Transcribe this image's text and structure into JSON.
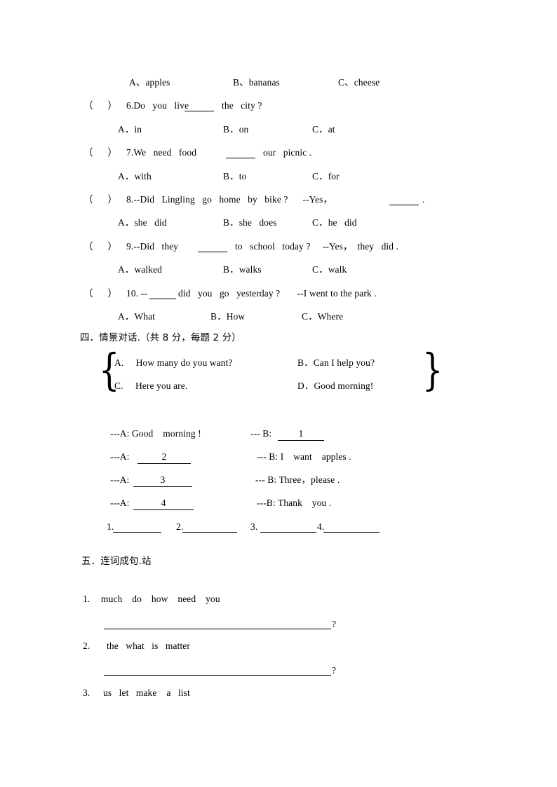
{
  "document": {
    "kind": "english-exam-worksheet-page"
  },
  "choices_top": {
    "a": "A、apples",
    "b": "B、bananas",
    "c": "C、cheese"
  },
  "multiple_choice": [
    {
      "marker": "（      ）",
      "stem_before": "6.Do   you   live",
      "stem_after": "the   city ?",
      "tail": "",
      "options": {
        "a": "A．in",
        "b": "B．on",
        "c": "C．at"
      }
    },
    {
      "marker": "（      ）",
      "stem_before": "7.We   need   food",
      "stem_after": "our   picnic .",
      "tail": "",
      "options": {
        "a": "A．with",
        "b": "B．to",
        "c": "C．for"
      }
    },
    {
      "marker": "（      ）",
      "stem_before": "8.--Did   Lingling   go   home   by   bike ?      --Yes，",
      "stem_after": ".",
      "tail": "",
      "options": {
        "a": "A．she   did",
        "b": "B．she   does",
        "c": "C．he   did"
      }
    },
    {
      "marker": "（      ）",
      "stem_before": "9.--Did   they",
      "stem_after": "to   school   today ?     --Yes，  they   did .",
      "tail": "",
      "options": {
        "a": "A．walked",
        "b": "B．walks",
        "c": "C．walk"
      }
    },
    {
      "marker": "（      ）",
      "stem_before": "10. --",
      "stem_after": "did   you   go   yesterday ?       --I went to the park .",
      "tail": "",
      "options": {
        "a": "A．What",
        "b": "B．How",
        "c": "C．Where"
      }
    }
  ],
  "section_four": {
    "heading": "四．情景对话.（共 8 分，每题 2 分）",
    "option_box": {
      "a": "A.     How many do you want?",
      "b": "B．Can I help you?",
      "c": "C.     Here you are.",
      "d": "D．Good morning!"
    },
    "dialogue": [
      {
        "left": "---A: Good    morning !",
        "left_slot": "",
        "right": "--- B:",
        "right_slot": "1"
      },
      {
        "left": "---A:",
        "left_slot": "2",
        "right": "--- B: I    want    apples .",
        "right_slot": ""
      },
      {
        "left": "---A:",
        "left_slot": "3",
        "right": "--- B: Three，please .",
        "right_slot": ""
      },
      {
        "left": "---A:",
        "left_slot": "4",
        "right": "---B: Thank    you .",
        "right_slot": ""
      }
    ],
    "answer_blanks": [
      "1.",
      "2.",
      "3.",
      "4."
    ]
  },
  "section_five": {
    "heading": "五．连词成句.站",
    "items": [
      {
        "number": "1.",
        "words": "much    do    how    need    you",
        "end_mark": "?"
      },
      {
        "number": "2.",
        "words": "the   what   is   matter",
        "end_mark": "?"
      },
      {
        "number": "3.",
        "words": "us   let   make    a   list",
        "end_mark": ""
      }
    ]
  }
}
